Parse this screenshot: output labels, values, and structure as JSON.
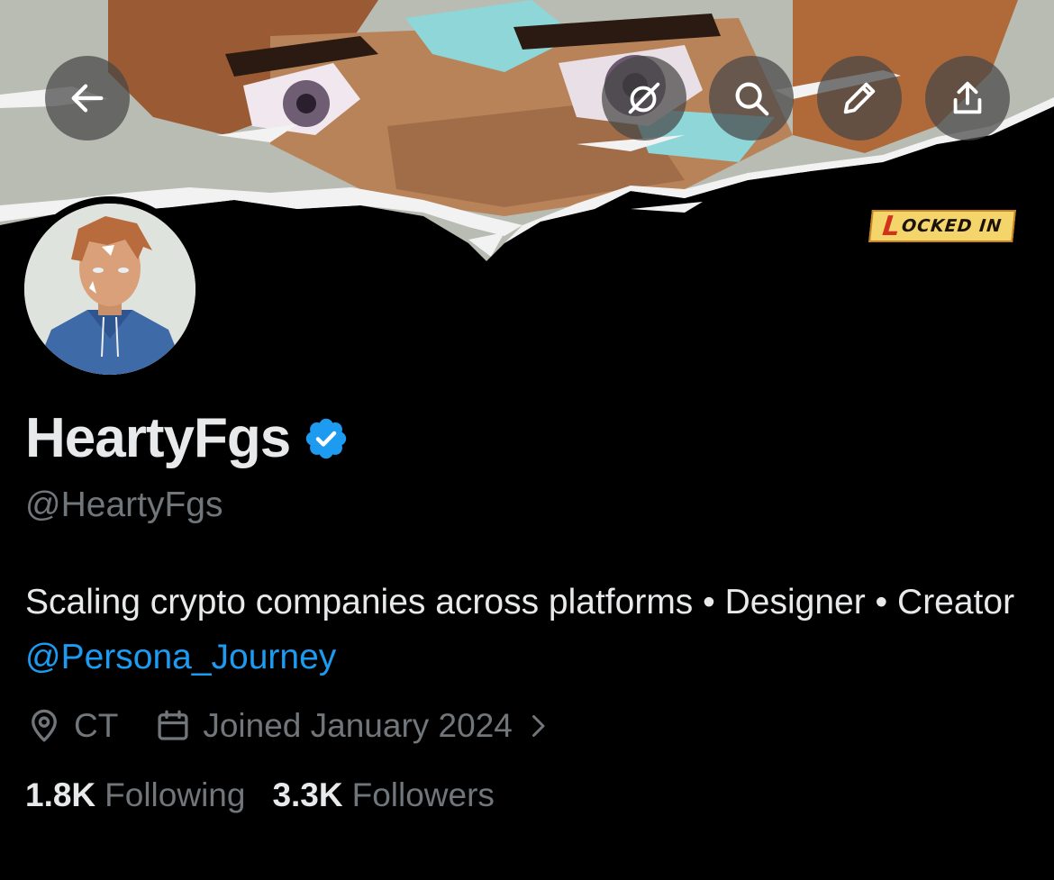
{
  "header": {
    "banner_sticker_prefix": "L",
    "banner_sticker_text": "OCKED IN",
    "buttons": {
      "back": "arrow-left-icon",
      "grok": "grok-icon",
      "search": "search-icon",
      "edit": "pencil-icon",
      "share": "share-icon"
    }
  },
  "profile": {
    "display_name": "HeartyFgs",
    "verified": true,
    "handle": "@HeartyFgs",
    "bio_text": "Scaling crypto companies across platforms • Designer • Creator",
    "bio_mention": "@Persona_Journey",
    "location": "CT",
    "joined": "Joined January 2024",
    "following_count": "1.8K",
    "following_label": "Following",
    "followers_count": "3.3K",
    "followers_label": "Followers"
  },
  "colors": {
    "background": "#000000",
    "text_primary": "#e7e9ea",
    "text_secondary": "#71767b",
    "accent": "#1d9bf0"
  }
}
